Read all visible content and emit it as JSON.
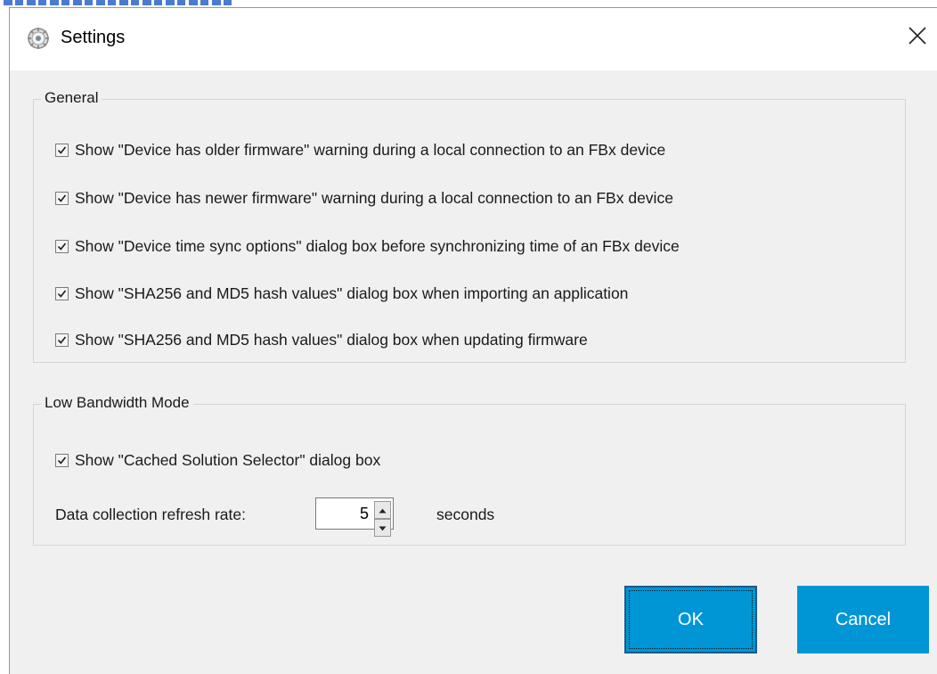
{
  "window": {
    "title": "Settings",
    "close_icon": "close-icon",
    "app_icon": "gear-icon"
  },
  "general": {
    "legend": "General",
    "options": [
      {
        "label": "Show \"Device has older firmware\" warning during a local connection to an FBx device",
        "checked": true
      },
      {
        "label": "Show \"Device has newer firmware\" warning during a local connection to an FBx device",
        "checked": true
      },
      {
        "label": "Show \"Device time sync options\" dialog box before synchronizing time of an FBx device",
        "checked": true
      },
      {
        "label": "Show \"SHA256 and MD5 hash values\" dialog box when importing an application",
        "checked": true
      },
      {
        "label": "Show \"SHA256 and MD5 hash values\" dialog box when updating firmware",
        "checked": true
      }
    ]
  },
  "low_bandwidth": {
    "legend": "Low Bandwidth Mode",
    "cached_selector": {
      "label": "Show \"Cached Solution Selector\" dialog box",
      "checked": true
    },
    "refresh_label": "Data collection refresh rate:",
    "refresh_value": "5",
    "refresh_unit": "seconds"
  },
  "buttons": {
    "ok": "OK",
    "cancel": "Cancel"
  },
  "colors": {
    "button_bg": "#0096d6",
    "dialog_bg": "#f0f0f0",
    "title_bg": "#ffffff"
  }
}
